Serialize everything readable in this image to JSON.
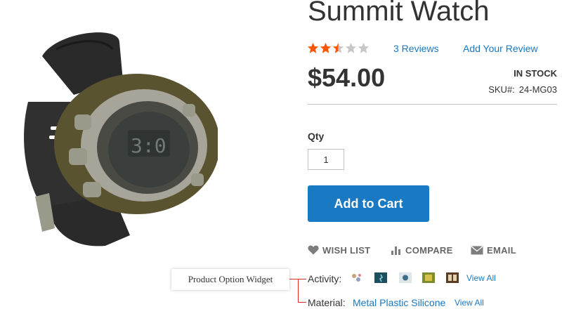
{
  "product": {
    "title": "Summit Watch",
    "rating": 2.5,
    "rating_max": 5,
    "reviews_link": "3 Reviews",
    "add_review_link": "Add Your Review",
    "price": "$54.00",
    "stock_status": "IN STOCK",
    "sku_label": "SKU#:",
    "sku_value": "24-MG03"
  },
  "qty": {
    "label": "Qty",
    "value": "1"
  },
  "buttons": {
    "add_to_cart": "Add to Cart"
  },
  "actions": {
    "wishlist": "WISH LIST",
    "compare": "COMPARE",
    "email": "EMAIL"
  },
  "widget": {
    "tooltip": "Product Option Widget"
  },
  "attributes": {
    "activity_label": "Activity:",
    "activity_view_all": "View All",
    "material_label": "Material:",
    "material_values": "Metal Plastic Silicone",
    "material_view_all": "View All"
  },
  "colors": {
    "accent": "#1979c3",
    "star_filled": "#ff5501",
    "star_empty": "#c7c7c7",
    "bracket": "#e02b27"
  },
  "icons": {
    "wishlist": "heart-icon",
    "compare": "bar-chart-icon",
    "email": "envelope-icon"
  }
}
